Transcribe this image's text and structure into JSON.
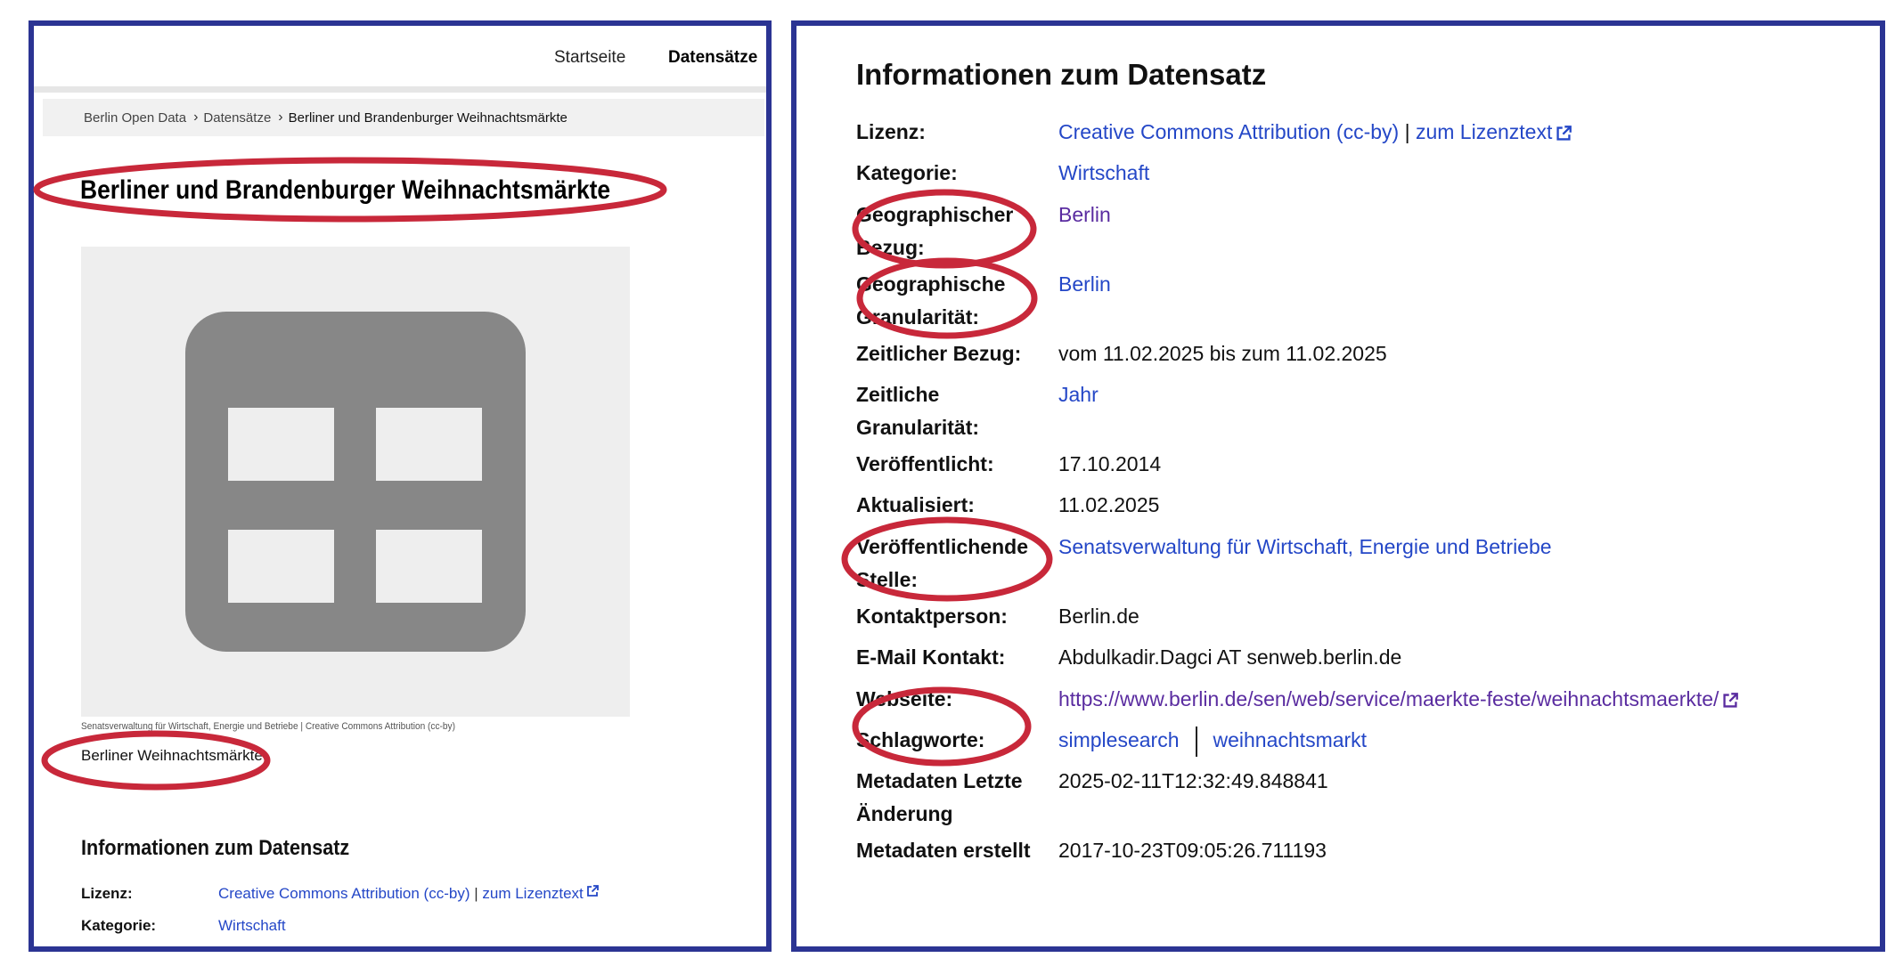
{
  "left": {
    "nav": {
      "home": "Startseite",
      "datasets": "Datensätze"
    },
    "breadcrumb": {
      "items": [
        "Berlin Open Data",
        "Datensätze",
        "Berliner und Brandenburger Weihnachtsmärkte"
      ]
    },
    "title": "Berliner und Brandenburger Weihnachtsmärkte",
    "thumbnail": {
      "icon": "table-icon",
      "caption": "Senatsverwaltung für Wirtschaft, Energie und Betriebe | Creative Commons Attribution (cc-by)"
    },
    "resource_name": "Berliner Weihnachtsmärkte",
    "info": {
      "heading": "Informationen zum Datensatz",
      "rows": [
        {
          "label": "Lizenz:",
          "value": "Creative Commons Attribution (cc-by)",
          "separator": "|",
          "extra": "zum Lizenztext"
        },
        {
          "label": "Kategorie:",
          "value": "Wirtschaft"
        }
      ]
    }
  },
  "right": {
    "heading": "Informationen zum Datensatz",
    "rows": [
      {
        "label": "Lizenz:",
        "value": "Creative Commons Attribution (cc-by)",
        "separator": "|",
        "extra": "zum Lizenztext"
      },
      {
        "label": "Kategorie:",
        "value": "Wirtschaft"
      },
      {
        "label": "Geographischer Bezug:",
        "value": "Berlin"
      },
      {
        "label": "Geographische Granularität:",
        "value": "Berlin"
      },
      {
        "label": "Zeitlicher Bezug:",
        "value": "vom 11.02.2025 bis zum 11.02.2025"
      },
      {
        "label": "Zeitliche Granularität:",
        "value": "Jahr"
      },
      {
        "label": "Veröffentlicht:",
        "value": "17.10.2014"
      },
      {
        "label": "Aktualisiert:",
        "value": "11.02.2025"
      },
      {
        "label": "Veröffentlichende Stelle:",
        "value": "Senatsverwaltung für Wirtschaft, Energie und Betriebe"
      },
      {
        "label": "Kontaktperson:",
        "value": "Berlin.de"
      },
      {
        "label": "E-Mail Kontakt:",
        "value": "Abdulkadir.Dagci AT senweb.berlin.de"
      },
      {
        "label": "Webseite:",
        "value": "https://www.berlin.de/sen/web/service/maerkte-feste/weihnachtsmaerkte/"
      },
      {
        "label": "Schlagworte:",
        "tags": [
          "simplesearch",
          "weihnachtsmarkt"
        ]
      },
      {
        "label": "Metadaten Letzte Änderung",
        "value": "2025-02-11T12:32:49.848841"
      },
      {
        "label": "Metadaten erstellt",
        "value": "2017-10-23T09:05:26.711193"
      }
    ]
  },
  "colors": {
    "frame": "#2b3493",
    "annotation": "#c8283a",
    "link": "#2447c7",
    "visited_link": "#5a2ca0",
    "icon_gray": "#878787"
  }
}
